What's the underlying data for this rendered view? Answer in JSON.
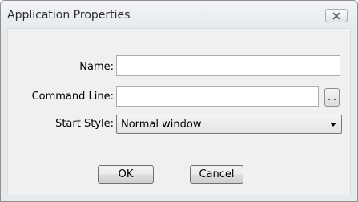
{
  "dialog": {
    "title": "Application Properties",
    "close_icon": "close-icon"
  },
  "form": {
    "name_label": "Name:",
    "name_value": "",
    "command_label": "Command Line:",
    "command_value": "",
    "browse_label": "...",
    "start_style_label": "Start Style:",
    "start_style_value": "Normal window"
  },
  "buttons": {
    "ok_label": "OK",
    "cancel_label": "Cancel"
  },
  "colors": {
    "window_frame": "#e7eaed",
    "content_bg": "#f0f0f0",
    "input_border": "#abadb3"
  }
}
